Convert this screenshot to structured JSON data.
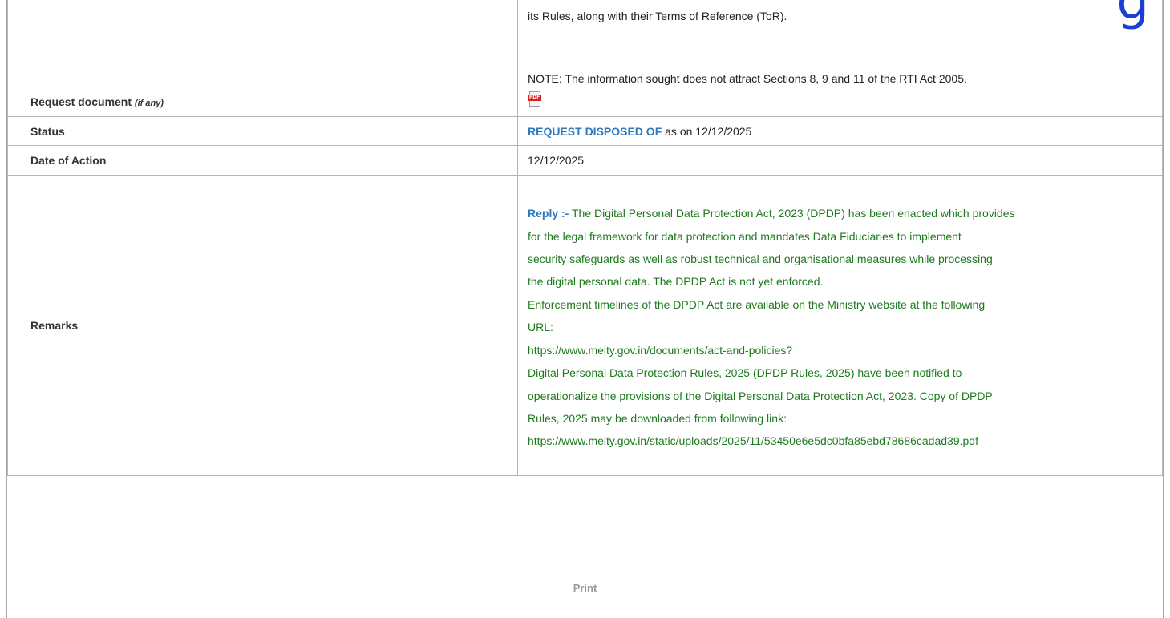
{
  "top_row": {
    "continuation_text": "its Rules, along with their Terms of Reference (ToR).",
    "note_text": "NOTE: The information sought does not attract Sections 8, 9 and 11 of the RTI Act 2005."
  },
  "request_document": {
    "label": "Request document",
    "hint": "(if any)",
    "icon": "pdf-file-icon",
    "icon_text": "PDF"
  },
  "status": {
    "label": "Status",
    "value": "REQUEST DISPOSED OF",
    "suffix": "as on 12/12/2025",
    "value_color": "#2d7bbf"
  },
  "date_of_action": {
    "label": "Date of Action",
    "value": "12/12/2025"
  },
  "remarks": {
    "label": "Remarks",
    "reply_label": "Reply :-",
    "text_color": "#1f7a1f",
    "lines": [
      "The Digital Personal Data Protection Act, 2023 (DPDP) has been enacted which provides",
      "for the legal framework for data protection and mandates Data Fiduciaries to implement",
      "security safeguards as well as robust technical and organisational measures while processing",
      "the digital personal data. The DPDP Act is not yet enforced.",
      "Enforcement timelines of the DPDP Act are available on the Ministry website at the following",
      "URL:",
      "https://www.meity.gov.in/documents/act-and-policies?",
      "Digital Personal Data Protection Rules, 2025 (DPDP Rules, 2025) have been notified to",
      "operationalize the provisions of the Digital Personal Data Protection Act, 2023. Copy of DPDP",
      "Rules, 2025 may be downloaded from following link:",
      "https://www.meity.gov.in/static/uploads/2025/11/53450e6e5dc0bfa85ebd78686cadad39.pdf"
    ]
  },
  "actions": {
    "print_label": "Print"
  }
}
